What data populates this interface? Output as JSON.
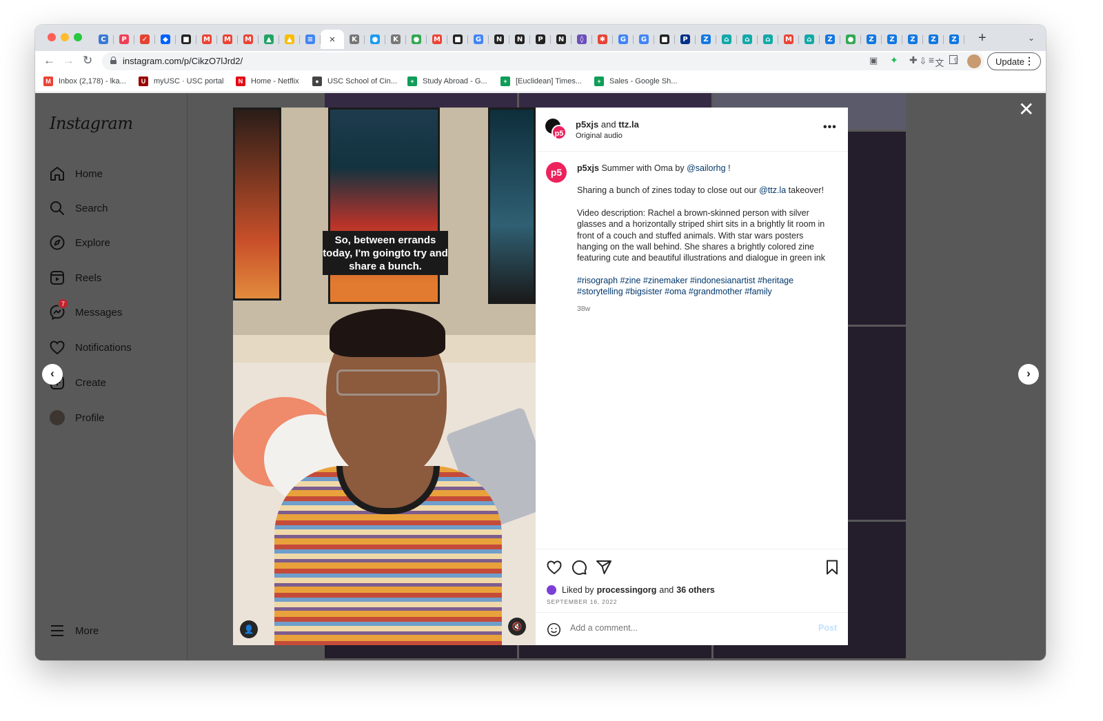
{
  "browser": {
    "tabs": [
      {
        "icon": "chatgpt-icon",
        "color": "#3a7bd5",
        "glyph": "C"
      },
      {
        "icon": "pocket-icon",
        "color": "#ef3f56",
        "glyph": "P"
      },
      {
        "icon": "todoist-icon",
        "color": "#e44332",
        "glyph": "✓"
      },
      {
        "icon": "dropbox-icon",
        "color": "#0061fe",
        "glyph": "◆"
      },
      {
        "icon": "app-icon",
        "color": "#222222",
        "glyph": "■"
      },
      {
        "icon": "gmail-icon",
        "color": "#ea4335",
        "glyph": "M"
      },
      {
        "icon": "gmail-icon",
        "color": "#ea4335",
        "glyph": "M"
      },
      {
        "icon": "gmail-icon",
        "color": "#ea4335",
        "glyph": "M"
      },
      {
        "icon": "drive-icon",
        "color": "#1fa463",
        "glyph": "▲"
      },
      {
        "icon": "drive-icon",
        "color": "#fbbc04",
        "glyph": "▲"
      },
      {
        "icon": "docs-icon",
        "color": "#4285f4",
        "glyph": "≡"
      },
      {
        "icon": "close-icon",
        "color": "",
        "glyph": "×",
        "active": true
      },
      {
        "icon": "k-icon",
        "color": "#777777",
        "glyph": "K"
      },
      {
        "icon": "app-icon",
        "color": "#1d9bf0",
        "glyph": "●"
      },
      {
        "icon": "k-icon",
        "color": "#777777",
        "glyph": "K"
      },
      {
        "icon": "chrome-icon",
        "color": "#34a853",
        "glyph": "●"
      },
      {
        "icon": "gmail-icon",
        "color": "#ea4335",
        "glyph": "M"
      },
      {
        "icon": "app-icon",
        "color": "#222222",
        "glyph": "■"
      },
      {
        "icon": "google-icon",
        "color": "#4285f4",
        "glyph": "G"
      },
      {
        "icon": "notion-icon",
        "color": "#222222",
        "glyph": "N"
      },
      {
        "icon": "notion-icon",
        "color": "#222222",
        "glyph": "N"
      },
      {
        "icon": "ps-icon",
        "color": "#222222",
        "glyph": "P"
      },
      {
        "icon": "notion-icon",
        "color": "#222222",
        "glyph": "N"
      },
      {
        "icon": "app-icon",
        "color": "#6b4fbb",
        "glyph": "◊"
      },
      {
        "icon": "app-icon",
        "color": "#e94235",
        "glyph": "✱"
      },
      {
        "icon": "google-icon",
        "color": "#4285f4",
        "glyph": "G"
      },
      {
        "icon": "google-icon",
        "color": "#4285f4",
        "glyph": "G"
      },
      {
        "icon": "app-icon",
        "color": "#222222",
        "glyph": "■"
      },
      {
        "icon": "paypal-icon",
        "color": "#003087",
        "glyph": "P"
      },
      {
        "icon": "zillow-icon",
        "color": "#1277e1",
        "glyph": "Z"
      },
      {
        "icon": "home-icon",
        "color": "#12a8a8",
        "glyph": "⌂"
      },
      {
        "icon": "home-icon",
        "color": "#12a8a8",
        "glyph": "⌂"
      },
      {
        "icon": "home-icon",
        "color": "#12a8a8",
        "glyph": "⌂"
      },
      {
        "icon": "gmail-icon",
        "color": "#ea4335",
        "glyph": "M"
      },
      {
        "icon": "home-icon",
        "color": "#12a8a8",
        "glyph": "⌂"
      },
      {
        "icon": "zillow-icon",
        "color": "#1277e1",
        "glyph": "Z"
      },
      {
        "icon": "maps-icon",
        "color": "#34a853",
        "glyph": "●"
      },
      {
        "icon": "zillow-icon",
        "color": "#1277e1",
        "glyph": "Z"
      },
      {
        "icon": "zillow-icon",
        "color": "#1277e1",
        "glyph": "Z"
      },
      {
        "icon": "zillow-icon",
        "color": "#1277e1",
        "glyph": "Z"
      },
      {
        "icon": "zillow-icon",
        "color": "#1277e1",
        "glyph": "Z"
      },
      {
        "icon": "zillow-icon",
        "color": "#1277e1",
        "glyph": "Z"
      }
    ],
    "url": "instagram.com/p/CikzO7lJrd2/",
    "update_label": "Update",
    "bookmarks": [
      {
        "label": "Inbox (2,178) - lka...",
        "icon": "gmail-icon",
        "color": "#ea4335",
        "glyph": "M"
      },
      {
        "label": "myUSC · USC portal",
        "icon": "usc-icon",
        "color": "#990000",
        "glyph": "U"
      },
      {
        "label": "Home - Netflix",
        "icon": "netflix-icon",
        "color": "#e50914",
        "glyph": "N"
      },
      {
        "label": "USC School of Cin...",
        "icon": "usc-cinema-icon",
        "color": "#444444",
        "glyph": "●"
      },
      {
        "label": "Study Abroad - G...",
        "icon": "sheets-icon",
        "color": "#0f9d58",
        "glyph": "+"
      },
      {
        "label": "[Euclidean] Times...",
        "icon": "sheets-icon",
        "color": "#0f9d58",
        "glyph": "+"
      },
      {
        "label": "Sales - Google Sh...",
        "icon": "sheets-icon",
        "color": "#0f9d58",
        "glyph": "+"
      }
    ]
  },
  "instagram": {
    "logo": "Instagram",
    "nav": {
      "home": "Home",
      "search": "Search",
      "explore": "Explore",
      "reels": "Reels",
      "messages": "Messages",
      "messages_badge": "7",
      "notifications": "Notifications",
      "create": "Create",
      "profile": "Profile",
      "more": "More"
    },
    "post": {
      "video_caption": "So, between errands today, I'm goingto try and share a bunch.",
      "header": {
        "user1": "p5xjs",
        "and": "and",
        "user2": "ttz.la",
        "subtitle": "Original audio"
      },
      "caption": {
        "username": "p5xjs",
        "line1_text": "Summer with Oma by",
        "line1_mention": "@sailorhg",
        "line1_end": "!",
        "line2_text": "Sharing a bunch of zines today to close out our",
        "line2_mention": "@ttz.la",
        "line2_end": "takeover!",
        "description": "Video description: Rachel a brown-skinned person with silver glasses and a horizontally striped shirt sits in a brightly lit room in front of a couch and stuffed animals. With star wars posters hanging on the wall behind. She shares a brightly colored zine featuring cute and beautiful illustrations and dialogue in green ink",
        "hashtags": "#risograph #zine #zinemaker #indonesianartist #heritage #storytelling #bigsister #oma #grandmother #family",
        "time": "38w"
      },
      "likes": {
        "prefix": "Liked by",
        "user": "processingorg",
        "and": "and",
        "count": "36 others"
      },
      "date": "SEPTEMBER 16, 2022",
      "comment_placeholder": "Add a comment...",
      "post_label": "Post"
    }
  },
  "colors": {
    "overlay": "#585858",
    "p5_pink": "#ed225d",
    "link": "#00376b",
    "post_disabled": "#c0dffd"
  }
}
